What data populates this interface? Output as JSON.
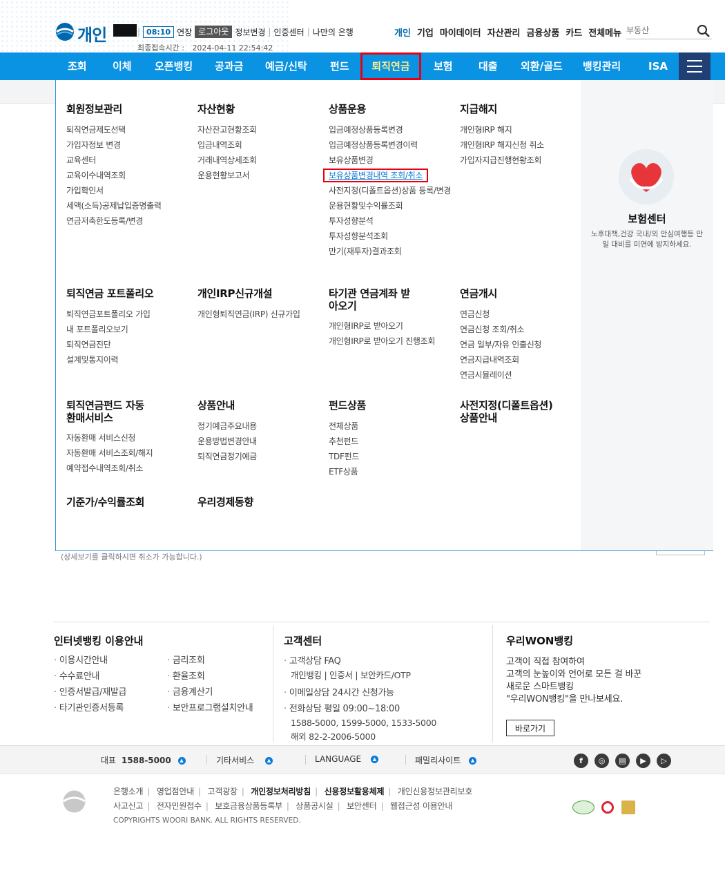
{
  "header": {
    "brand": "개인",
    "timer": "08:10",
    "extend": "연장",
    "logout": "로그아웃",
    "info_change": "정보변경",
    "cert_center": "인증센터",
    "my_bank": "나만의 은행",
    "last_login_label": "최종접속시간 :",
    "last_login_value": "2024-04-11 22:54:42",
    "top_menu": [
      "개인",
      "기업",
      "마이데이터",
      "자산관리",
      "금융상품",
      "카드",
      "전체메뉴"
    ],
    "search_placeholder": "부동산"
  },
  "gnb": {
    "items": [
      "조회",
      "이체",
      "오픈뱅킹",
      "공과금",
      "예금/신탁",
      "펀드",
      "퇴직연금",
      "보험",
      "대출",
      "외환/골드",
      "뱅킹관리",
      "ISA"
    ],
    "active_index": 6
  },
  "mega": {
    "row1": [
      {
        "title": "회원정보관리",
        "links": [
          "퇴직연금제도선택",
          "가입자정보 변경",
          "교육센터",
          "교육이수내역조회",
          "가입확인서",
          "세액(소득)공제납입증명출력",
          "연금저축한도등록/변경"
        ]
      },
      {
        "title": "자산현황",
        "links": [
          "자산잔고현황조회",
          "입금내역조회",
          "거래내역상세조회",
          "운용현황보고서"
        ]
      },
      {
        "title": "상품운용",
        "links": [
          "입금예정상품등록변경",
          "입금예정상품등록변경이력",
          "보유상품변경",
          "보유상품변경내역 조회/취소",
          "사전지정(디폴트옵션)상품 등록/변경",
          "운용현황및수익률조회",
          "투자성향분석",
          "투자성향분석조회",
          "만기(재투자)결과조회"
        ]
      },
      {
        "title": "지급해지",
        "links": [
          "개인형IRP 해지",
          "개인형IRP 해지신청 취소",
          "가입자지급진행현황조회"
        ]
      }
    ],
    "row2": [
      {
        "title": "퇴직연금 포트폴리오",
        "links": [
          "퇴직연금포트폴리오 가입",
          "내 포트폴리오보기",
          "퇴직연금진단",
          "설계및통지이력"
        ]
      },
      {
        "title": "개인IRP신규개설",
        "links": [
          "개인형퇴직연금(IRP) 신규가입"
        ]
      },
      {
        "title": "타기관 연금계좌 받아오기",
        "links": [
          "개인형IRP로 받아오기",
          "개인형IRP로 받아오기 진행조회"
        ]
      },
      {
        "title": "연금개시",
        "links": [
          "연금신청",
          "연금신청 조회/취소",
          "연금 일부/자유 인출신청",
          "연금지급내역조회",
          "연금시뮬레이션"
        ]
      }
    ],
    "row3": [
      {
        "title": "퇴직연금펀드 자동환매서비스",
        "links": [
          "자동환매 서비스신청",
          "자동환매 서비스조회/해지",
          "예약접수내역조회/취소"
        ]
      },
      {
        "title": "상품안내",
        "links": [
          "정기예금주요내용",
          "운용방법변경안내",
          "퇴직연금정기예금"
        ]
      },
      {
        "title": "펀드상품",
        "links": [
          "전체상품",
          "추천펀드",
          "TDF펀드",
          "ETF상품"
        ]
      },
      {
        "title": "사전지정(디폴트옵션) 상품안내",
        "links": []
      }
    ],
    "row4": [
      {
        "title": "기준가/수익률조회",
        "links": []
      },
      {
        "title": "우리경제동향",
        "links": []
      }
    ],
    "side": {
      "title": "보험센터",
      "desc": "노후대책,건강 국내/외 안심여행등 만일 대비를 미연에 방지하세요."
    }
  },
  "behind_note": "(상세보기를 클릭하시면 취소가 가능합니다.)",
  "footer_info": {
    "guide": {
      "title": "인터넷뱅킹 이용안내",
      "col1": [
        "이용시간안내",
        "수수료안내",
        "인증서발급/재발급",
        "타기관인증서등록"
      ],
      "col2": [
        "금리조회",
        "환율조회",
        "금융계산기",
        "보안프로그램설치안내"
      ]
    },
    "center": {
      "title": "고객센터",
      "faq": "고객상담 FAQ",
      "faq_sub": "개인뱅킹 | 인증서 | 보안카드/OTP",
      "email": "이메일상담 24시간 신청가능",
      "phone": "전화상담 평일 09:00~18:00",
      "phone_nums": "1588-5000, 1599-5000, 1533-5000",
      "overseas": "해외 82-2-2006-5000"
    },
    "won": {
      "title": "우리WON뱅킹",
      "desc": [
        "고객이 직접 참여하여",
        "고객의 눈높이와 언어로 모든 걸 바꾼",
        "새로운 스마트뱅킹",
        "\"우리WON뱅킹\"을 만나보세요."
      ],
      "button": "바로가기"
    }
  },
  "footer_bar": {
    "rep_label": "대표",
    "rep_number": "1588-5000",
    "other": "기타서비스",
    "language": "LANGUAGE",
    "family": "패밀리사이트"
  },
  "bottom": {
    "links1": [
      "은행소개",
      "영업점안내",
      "고객광장",
      "개인정보처리방침",
      "신용정보활용체제",
      "개인신용정보관리보호"
    ],
    "links2": [
      "사고신고",
      "전자민원접수",
      "보호금융상품등록부",
      "상품공시실",
      "보안센터",
      "웹접근성 이용안내"
    ],
    "copyright": "COPYRIGHTS WOORI BANK. ALL RIGHTS RESERVED."
  },
  "colors": {
    "brand": "#0067ac",
    "gnb": "#0a92e3",
    "highlight": "#e60012"
  }
}
